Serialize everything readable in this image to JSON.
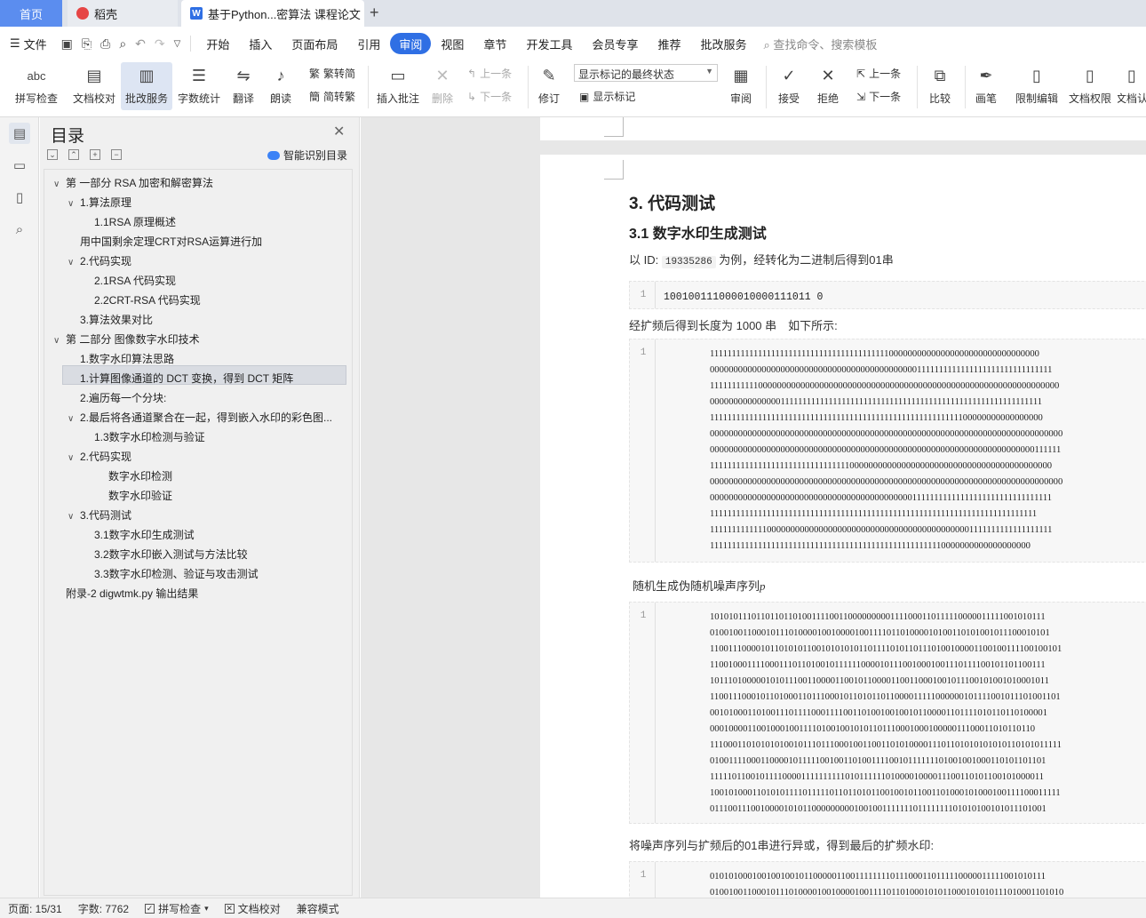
{
  "tabs": {
    "home": "首页",
    "daoke": "稻壳",
    "doc": "基于Python...密算法 课程论文",
    "add": "+"
  },
  "menu": {
    "file": "文件",
    "items": [
      "开始",
      "插入",
      "页面布局",
      "引用",
      "审阅",
      "视图",
      "章节",
      "开发工具",
      "会员专享",
      "推荐",
      "批改服务"
    ],
    "active_index": 4,
    "search": "查找命令、搜索模板"
  },
  "ribbon": {
    "spell": "拼写检查",
    "doccheck": "文档校对",
    "review_service": "批改服务",
    "wordcount": "字数统计",
    "translate": "翻译",
    "read": "朗读",
    "trad_to_simp": "繁转简",
    "simp_to_trad": "简转繁",
    "insert_comment": "插入批注",
    "delete": "删除",
    "prev": "上一条",
    "next": "下一条",
    "revise": "修订",
    "track_state": "显示标记的最终状态",
    "show_marks": "显示标记",
    "review": "审阅",
    "accept": "接受",
    "reject": "拒绝",
    "prev2": "上一条",
    "next2": "下一条",
    "compare": "比较",
    "pen": "画笔",
    "restrict_edit": "限制编辑",
    "doc_perm": "文档权限",
    "doc_more": "文档认"
  },
  "toc": {
    "title": "目录",
    "smart": "智能识别目录",
    "items": [
      {
        "text": "第 一部分 RSA 加密和解密算法",
        "level": 0,
        "chev": "∨"
      },
      {
        "text": "1.算法原理",
        "level": 1,
        "chev": "∨"
      },
      {
        "text": "1.1RSA 原理概述",
        "level": 2,
        "chev": ""
      },
      {
        "text": "用中国剩余定理CRT对RSA运算进行加",
        "level": 1,
        "chev": ""
      },
      {
        "text": "2.代码实现",
        "level": 1,
        "chev": "∨"
      },
      {
        "text": "2.1RSA 代码实现",
        "level": 2,
        "chev": ""
      },
      {
        "text": "2.2CRT-RSA 代码实现",
        "level": 2,
        "chev": ""
      },
      {
        "text": "3.算法效果对比",
        "level": 1,
        "chev": ""
      },
      {
        "text": "第 二部分 图像数字水印技术",
        "level": 0,
        "chev": "∨"
      },
      {
        "text": "1.数字水印算法思路",
        "level": 1,
        "chev": ""
      },
      {
        "text": "1.计算图像通道的 DCT 变换，得到 DCT 矩阵",
        "level": 1,
        "chev": ""
      },
      {
        "text": "2.遍历每一个分块:",
        "level": 1,
        "chev": ""
      },
      {
        "text": "2.最后将各通道聚合在一起，得到嵌入水印的彩色图...",
        "level": 1,
        "chev": "∨"
      },
      {
        "text": "1.3数字水印检测与验证",
        "level": 2,
        "chev": ""
      },
      {
        "text": "2.代码实现",
        "level": 1,
        "chev": "∨"
      },
      {
        "text": "数字水印检测",
        "level": 3,
        "chev": ""
      },
      {
        "text": "数字水印验证",
        "level": 3,
        "chev": ""
      },
      {
        "text": "3.代码测试",
        "level": 1,
        "chev": "∨"
      },
      {
        "text": "3.1数字水印生成测试",
        "level": 2,
        "chev": ""
      },
      {
        "text": "3.2数字水印嵌入测试与方法比较",
        "level": 2,
        "chev": ""
      },
      {
        "text": "3.3数字水印检测、验证与攻击测试",
        "level": 2,
        "chev": ""
      },
      {
        "text": "附录-2 digwtmk.py 输出结果",
        "level": 0,
        "chev": ""
      }
    ]
  },
  "doc": {
    "h1": "3. 代码测试",
    "h2": "3.1 数字水印生成测试",
    "p1_pre": "以 ID:",
    "p1_id": "19335286",
    "p1_post": "为例，经转化为二进制后得到01串",
    "cb1_ln": "1",
    "cb1": "100100111000010000111011 0",
    "p2": "经扩频后得到长度为 1000 串　如下所示:",
    "cb2_ln": "1",
    "cb2": [
      "1111111111111111111111111111111111111111100000000000000000000000000000000",
      "000000000000000000000000000000000000000000001111111111111111111111111111111",
      "111111111110000000000000000000000000000000000000000000000000000000000000000",
      "000000000000000111111111111111111111111111111111111111111111111111111111111",
      "111111111111111111111111111111111111111111111111111111111100000000000000000",
      "000000000000000000000000000000000000000000000000000000000000000000000000000",
      "000000000000000000000000000000000000000000000000000000000000000000000111111",
      "111111111111111111111111111111110000000000000000000000000000000000000000000",
      "000000000000000000000000000000000000000000000000000000000000000000000000000",
      "000000000000000000000000000000000000000000011111111111111111111111111111111",
      "111111111111111111111111111111111111111111111111111111111111111111111111111",
      "111111111111100000000000000000000000000000000000000000001111111111111111111",
      "111111111111111111111111111111111111111111111111111110000000000000000000"
    ],
    "p3": "随机生成伪随机噪声序列",
    "p3_var": "p",
    "cb3_ln": "1",
    "cb3": [
      "1010101110110110110100111100110000000001111000110111110000011111001010111",
      "0100100110001011101000010010000100111101101000010100110101001011100010101",
      "1100111000010110101011001010101011011110101101110100100001100100111100100101",
      "1100100011110001110110100101111110000101110010001001110111100101101100111",
      "1011101000001010111001100001100101100001100110001001011100101001010001011",
      "1100111000101101000110111000101101011011000011111000000101111001011101001101",
      "0010100011010011101111000111100110100100100101100001101111010110110100001",
      "0001000011001000100111101001001010110111000100010000011100011010110110",
      "1110001101010101001011101110001001100110101000011101101010101010110101011111",
      "0100111100011000010111110010011010011110010111111101001001000110101101101",
      "1111101100101111000011111111110101111110100001000011100110101100101000011",
      "1001010001101010111101111101101101011001001011001101000101000100111100011111",
      "0111001110010000101011000000000100100111111101111111101010100101011101001"
    ],
    "p4": "将噪声序列与扩频后的01串进行异或，得到最后的扩频水印:",
    "cb4_ln": "1",
    "cb4": [
      "0101010001001001001011000001100111111110111000110111110000011111001010111",
      "0100100110001011101000010010000100111101101000101011000101010111010001101010"
    ]
  },
  "status": {
    "page": "页面: 15/31",
    "words": "字数: 7762",
    "spell": "拼写检查",
    "doccheck": "文档校对",
    "compat": "兼容模式"
  }
}
